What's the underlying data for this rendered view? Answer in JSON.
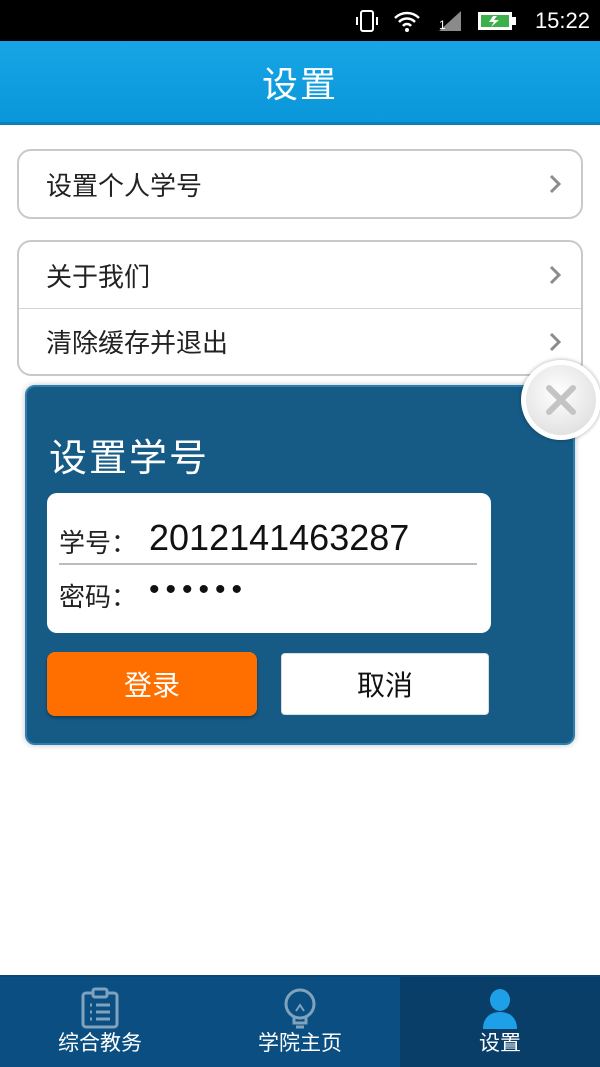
{
  "status_bar": {
    "time": "15:22",
    "icons": [
      "vibrate-icon",
      "wifi-icon",
      "signal-icon",
      "battery-icon"
    ]
  },
  "header": {
    "title": "设置"
  },
  "settings": {
    "groups": [
      {
        "items": [
          {
            "label": "设置个人学号"
          }
        ]
      },
      {
        "items": [
          {
            "label": "关于我们"
          },
          {
            "label": "清除缓存并退出"
          }
        ]
      }
    ]
  },
  "dialog": {
    "title": "设置学号",
    "student_id_label": "学号：",
    "student_id_value": "2012141463287",
    "password_label": "密码：",
    "password_value": "••••••",
    "login_label": "登录",
    "cancel_label": "取消"
  },
  "bottom_nav": {
    "items": [
      {
        "label": "综合教务",
        "icon": "clipboard-icon",
        "active": false
      },
      {
        "label": "学院主页",
        "icon": "lightbulb-icon",
        "active": false
      },
      {
        "label": "设置",
        "icon": "user-icon",
        "active": true
      }
    ]
  },
  "colors": {
    "header": "#0a97da",
    "dialog": "#165b86",
    "login_button": "#ff6f00",
    "bottom_nav": "#0b4f82",
    "active_icon": "#1ea0e8"
  }
}
